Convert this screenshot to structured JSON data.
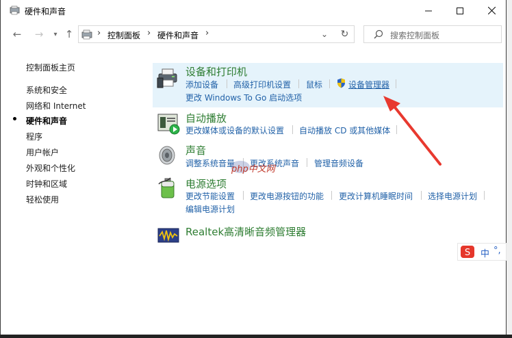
{
  "window": {
    "title": "硬件和声音"
  },
  "address": {
    "breadcrumbs": [
      "控制面板",
      "硬件和声音"
    ],
    "search_placeholder": "搜索控制面板"
  },
  "sidebar": {
    "items": [
      {
        "label": "控制面板主页"
      },
      {
        "label": "系统和安全"
      },
      {
        "label": "网络和 Internet"
      },
      {
        "label": "硬件和声音",
        "current": true
      },
      {
        "label": "程序"
      },
      {
        "label": "用户帐户"
      },
      {
        "label": "外观和个性化"
      },
      {
        "label": "时钟和区域"
      },
      {
        "label": "轻松使用"
      }
    ]
  },
  "categories": [
    {
      "title": "设备和打印机",
      "links": [
        "添加设备",
        "高级打印机设置",
        "鼠标",
        "设备管理器",
        "更改 Windows To Go 启动选项"
      ],
      "selected_link": "设备管理器"
    },
    {
      "title": "自动播放",
      "links": [
        "更改媒体或设备的默认设置",
        "自动播放 CD 或其他媒体"
      ]
    },
    {
      "title": "声音",
      "links": [
        "调整系统音量",
        "更改系统声音",
        "管理音频设备"
      ]
    },
    {
      "title": "电源选项",
      "links": [
        "更改节能设置",
        "更改电源按钮的功能",
        "更改计算机睡眠时间",
        "选择电源计划",
        "编辑电源计划"
      ]
    },
    {
      "title": "Realtek高清晰音频管理器",
      "links": []
    }
  ],
  "overlay": {
    "watermark": "php中文网",
    "ime_label": "中",
    "ime_punct": "°,"
  },
  "colors": {
    "link": "#2262a8",
    "category_title": "#2e7d32",
    "highlight": "#e5f3fb",
    "arrow": "#e8392f"
  },
  "icons": {
    "devices": "printer-device-icon",
    "autoplay": "autoplay-icon",
    "sound": "speaker-icon",
    "power": "battery-power-icon",
    "realtek": "realtek-audio-icon",
    "shield": "uac-shield-icon"
  }
}
